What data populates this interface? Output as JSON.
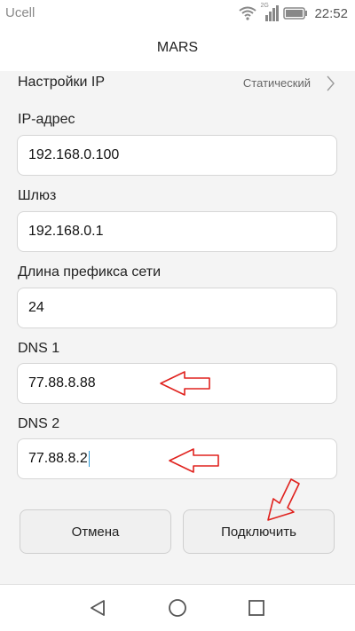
{
  "status_bar": {
    "carrier": "Ucell",
    "network_badge": "2G",
    "time": "22:52",
    "icons": [
      "wifi-icon",
      "signal-icon",
      "battery-icon"
    ]
  },
  "header": {
    "title": "MARS"
  },
  "ip_settings": {
    "label": "Настройки IP",
    "value": "Статический",
    "icon": "chevron-right-icon"
  },
  "fields": {
    "ip_address": {
      "label": "IP-адрес",
      "value": "192.168.0.100"
    },
    "gateway": {
      "label": "Шлюз",
      "value": "192.168.0.1"
    },
    "prefix_length": {
      "label": "Длина префикса сети",
      "value": "24"
    },
    "dns1": {
      "label": "DNS 1",
      "value": "77.88.8.88"
    },
    "dns2": {
      "label": "DNS 2",
      "value": "77.88.8.2"
    }
  },
  "buttons": {
    "cancel": "Отмена",
    "connect": "Подключить"
  },
  "nav_bar": {
    "icons": [
      "back-icon",
      "home-icon",
      "recents-icon"
    ]
  },
  "colors": {
    "annotation_arrow": "#e0221e",
    "caret": "#2e9ad6",
    "background": "#f4f4f4"
  }
}
